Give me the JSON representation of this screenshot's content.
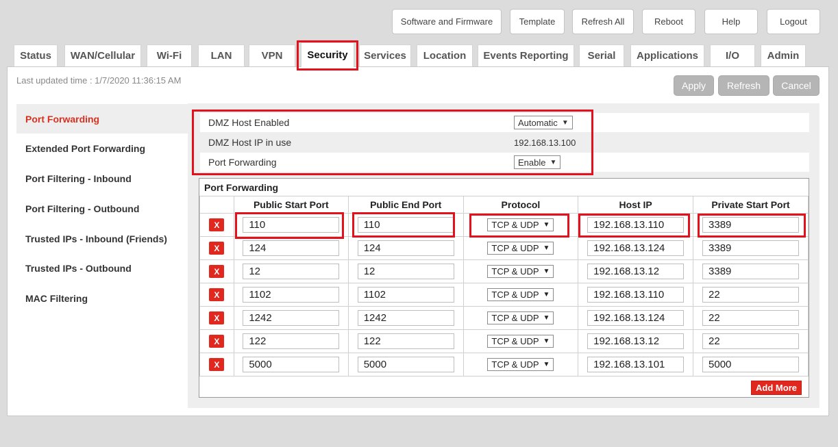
{
  "header": {
    "buttons": [
      "Software and Firmware",
      "Template",
      "Refresh All",
      "Reboot",
      "Help",
      "Logout"
    ]
  },
  "tabs": [
    "Status",
    "WAN/Cellular",
    "Wi-Fi",
    "LAN",
    "VPN",
    "Security",
    "Services",
    "Location",
    "Events Reporting",
    "Serial",
    "Applications",
    "I/O",
    "Admin"
  ],
  "active_tab": "Security",
  "status": {
    "last_updated": "Last updated time : 1/7/2020 11:36:15 AM"
  },
  "actions": {
    "apply": "Apply",
    "refresh": "Refresh",
    "cancel": "Cancel"
  },
  "sidebar": {
    "items": [
      "Port Forwarding",
      "Extended Port Forwarding",
      "Port Filtering - Inbound",
      "Port Filtering - Outbound",
      "Trusted IPs - Inbound (Friends)",
      "Trusted IPs - Outbound",
      "MAC Filtering"
    ]
  },
  "dmz": {
    "enabled_label": "DMZ Host Enabled",
    "enabled_value": "Automatic",
    "ip_label": "DMZ Host IP in use",
    "ip_value": "192.168.13.100",
    "pf_label": "Port Forwarding",
    "pf_value": "Enable"
  },
  "port_forwarding": {
    "title": "Port Forwarding",
    "columns": [
      "Public Start Port",
      "Public End Port",
      "Protocol",
      "Host IP",
      "Private Start Port"
    ],
    "delete_label": "X",
    "rows": [
      [
        "110",
        "110",
        "TCP & UDP",
        "192.168.13.110",
        "3389"
      ],
      [
        "124",
        "124",
        "TCP & UDP",
        "192.168.13.124",
        "3389"
      ],
      [
        "12",
        "12",
        "TCP & UDP",
        "192.168.13.12",
        "3389"
      ],
      [
        "1102",
        "1102",
        "TCP & UDP",
        "192.168.13.110",
        "22"
      ],
      [
        "1242",
        "1242",
        "TCP & UDP",
        "192.168.13.124",
        "22"
      ],
      [
        "122",
        "122",
        "TCP & UDP",
        "192.168.13.12",
        "22"
      ],
      [
        "5000",
        "5000",
        "TCP & UDP",
        "192.168.13.101",
        "5000"
      ]
    ],
    "add_more": "Add More"
  },
  "colors": {
    "accent": "#e0281f",
    "highlight": "#e3111b",
    "active_side": "#d9301f"
  },
  "icons": {
    "dropdown": "caret-down-icon",
    "delete": "x-icon"
  }
}
